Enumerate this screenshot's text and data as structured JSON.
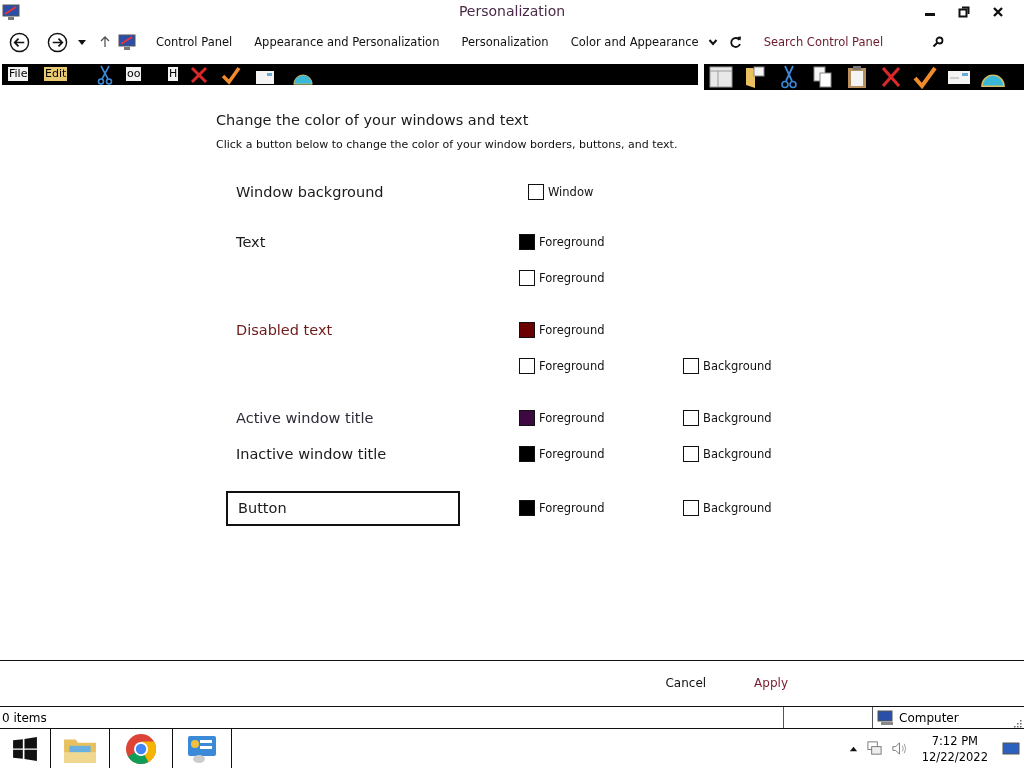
{
  "window": {
    "title": "Personalization"
  },
  "nav": {
    "breadcrumbs": [
      "Control Panel",
      "Appearance and Personalization",
      "Personalization",
      "Color and Appearance"
    ],
    "search": {
      "placeholder": "Search Control Panel"
    }
  },
  "toolbar": {
    "labels": [
      "File",
      "Edit",
      "oo",
      "H"
    ]
  },
  "heading": "Change the color of your windows and text",
  "description": "Click a button below to change the color of your window borders, buttons, and text.",
  "rows": [
    {
      "kind": "label",
      "label": "Window background",
      "color": "#1a1a1a",
      "swatches": [
        {
          "label": "Window",
          "color": "#ffffff"
        }
      ]
    },
    {
      "kind": "label",
      "label": "Text",
      "color": "#1a1a1a",
      "swatches": [
        {
          "label": "Foreground",
          "color": "#000000"
        }
      ]
    },
    {
      "kind": "none",
      "swatches": [
        {
          "label": "Foreground",
          "color": "#ffffff"
        }
      ]
    },
    {
      "kind": "label",
      "label": "Disabled text",
      "color": "#6d1a1a",
      "swatches": [
        {
          "label": "Foreground",
          "color": "#6b0000"
        }
      ]
    },
    {
      "kind": "none",
      "swatches": [
        {
          "label": "Foreground",
          "color": "#ffffff"
        },
        {
          "label": "Background",
          "color": "#ffffff"
        }
      ]
    },
    {
      "kind": "label",
      "label": "Active window title",
      "color": "#2e2a38",
      "swatches": [
        {
          "label": "Foreground",
          "color": "#3c0a40"
        },
        {
          "label": "Background",
          "color": "#ffffff"
        }
      ]
    },
    {
      "kind": "label",
      "label": "Inactive window title",
      "color": "#1a1a1a",
      "swatches": [
        {
          "label": "Foreground",
          "color": "#000000"
        },
        {
          "label": "Background",
          "color": "#ffffff"
        }
      ]
    },
    {
      "kind": "button",
      "label": "Button",
      "color": "#1a1a1a",
      "swatches": [
        {
          "label": "Foreground",
          "color": "#000000"
        },
        {
          "label": "Background",
          "color": "#ffffff"
        }
      ]
    }
  ],
  "buttons": [
    "Cancel",
    "Apply"
  ],
  "status_bar": {
    "items": "0 items",
    "location": "Computer"
  },
  "taskbar": {
    "time": "7:12 PM",
    "date": "12/22/2022"
  }
}
